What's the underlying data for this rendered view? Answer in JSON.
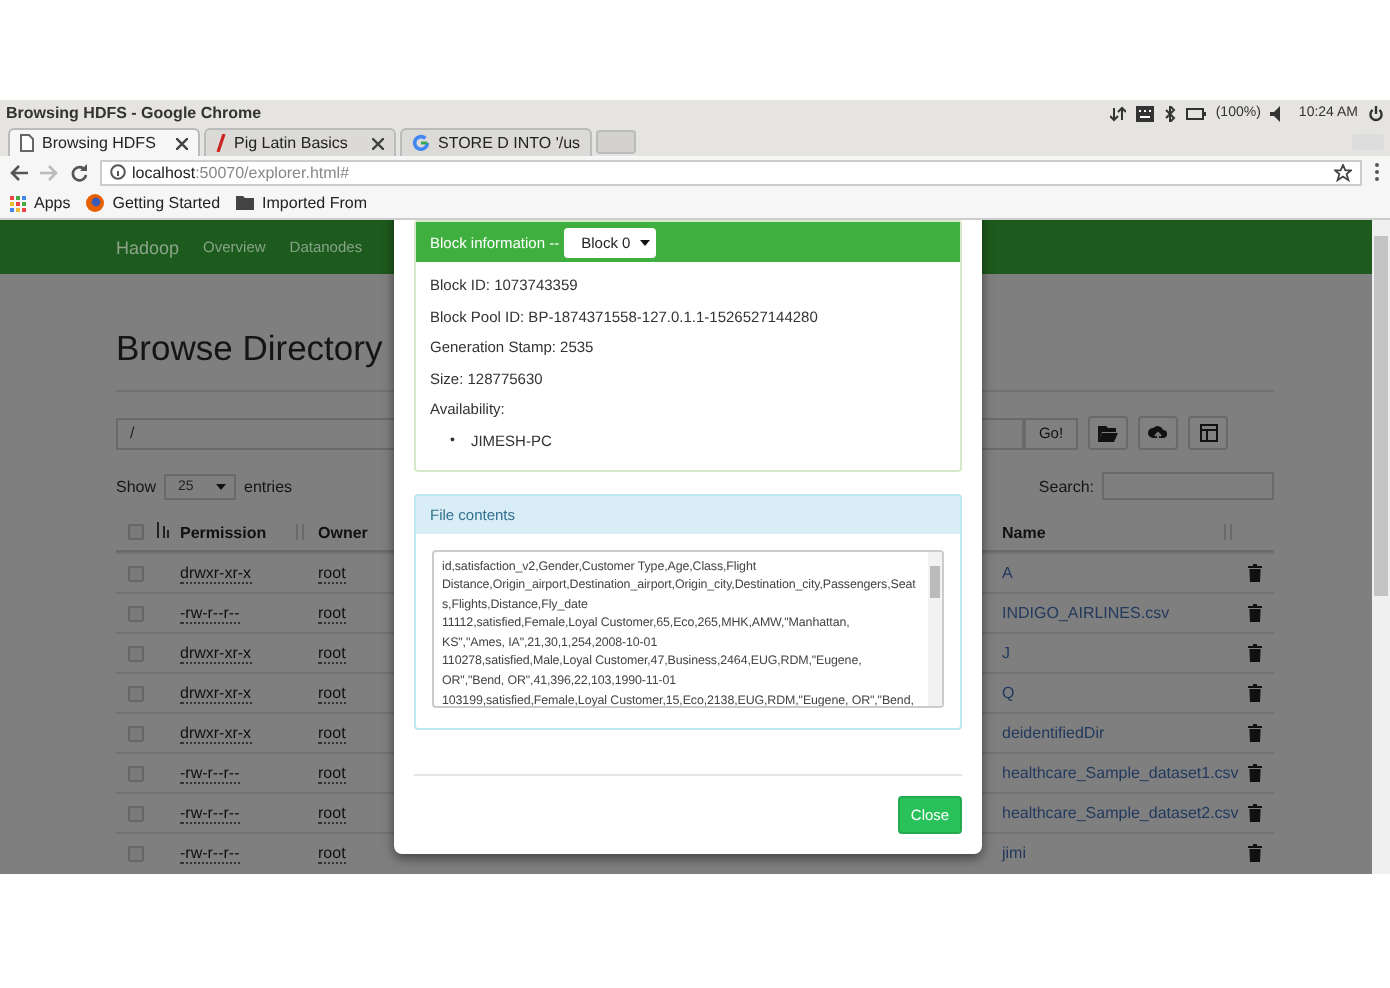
{
  "os_bar": {
    "title": "Browsing HDFS - Google Chrome",
    "battery": "(100%)",
    "time": "10:24 AM"
  },
  "browser": {
    "tabs": [
      {
        "title": "Browsing HDFS",
        "kind": "page",
        "selected": true
      },
      {
        "title": "Pig Latin Basics",
        "kind": "pig",
        "selected": false
      },
      {
        "title": "STORE D INTO '/us",
        "kind": "google",
        "selected": false
      }
    ],
    "url_host": "localhost",
    "url_rest": ":50070/explorer.html#",
    "bookmarks": [
      {
        "label": "Apps",
        "kind": "apps"
      },
      {
        "label": "Getting Started",
        "kind": "firefox"
      },
      {
        "label": "Imported From",
        "kind": "folder"
      }
    ]
  },
  "navbar": {
    "brand": "Hadoop",
    "links": [
      "Overview",
      "Datanodes"
    ]
  },
  "page": {
    "heading": "Browse Directory",
    "path": "/",
    "go": "Go!",
    "show": "Show",
    "entries_value": "25",
    "entries": "entries",
    "search_label": "Search:",
    "select_all_checked": false,
    "columns": [
      "Permission",
      "Owner",
      "Name"
    ],
    "rows": [
      {
        "checked": false,
        "permission": "drwxr-xr-x",
        "owner": "root",
        "name": "A"
      },
      {
        "checked": false,
        "permission": "-rw-r--r--",
        "owner": "root",
        "name": "INDIGO_AIRLINES.csv"
      },
      {
        "checked": false,
        "permission": "drwxr-xr-x",
        "owner": "root",
        "name": "J"
      },
      {
        "checked": false,
        "permission": "drwxr-xr-x",
        "owner": "root",
        "name": "Q"
      },
      {
        "checked": false,
        "permission": "drwxr-xr-x",
        "owner": "root",
        "name": "deidentifiedDir"
      },
      {
        "checked": false,
        "permission": "-rw-r--r--",
        "owner": "root",
        "name": "healthcare_Sample_dataset1.csv"
      },
      {
        "checked": false,
        "permission": "-rw-r--r--",
        "owner": "root",
        "name": "healthcare_Sample_dataset2.csv"
      },
      {
        "checked": false,
        "permission": "-rw-r--r--",
        "owner": "root",
        "name": "jimi"
      }
    ]
  },
  "modal": {
    "block_label": "Block information --",
    "block_select": "Block 0",
    "fields": [
      "Block ID: 1073743359",
      "Block Pool ID: BP-1874371558-127.0.1.1-1526527144280",
      "Generation Stamp: 2535",
      "Size: 128775630",
      "Availability:"
    ],
    "availability_marker": "•",
    "availability": [
      "JIMESH-PC"
    ],
    "file_contents_title": "File contents",
    "file_lines": [
      "id,satisfaction_v2,Gender,Customer Type,Age,Class,Flight",
      "Distance,Origin_airport,Destination_airport,Origin_city,Destination_city,Passengers,Seat",
      "s,Flights,Distance,Fly_date",
      "11112,satisfied,Female,Loyal Customer,65,Eco,265,MHK,AMW,\"Manhattan,",
      "KS\",\"Ames, IA\",21,30,1,254,2008-10-01",
      "110278,satisfied,Male,Loyal Customer,47,Business,2464,EUG,RDM,\"Eugene,",
      "OR\",\"Bend, OR\",41,396,22,103,1990-11-01",
      "103199,satisfied,Female,Loyal Customer,15,Eco,2138,EUG,RDM,\"Eugene, OR\",\"Bend,"
    ],
    "close": "Close"
  }
}
